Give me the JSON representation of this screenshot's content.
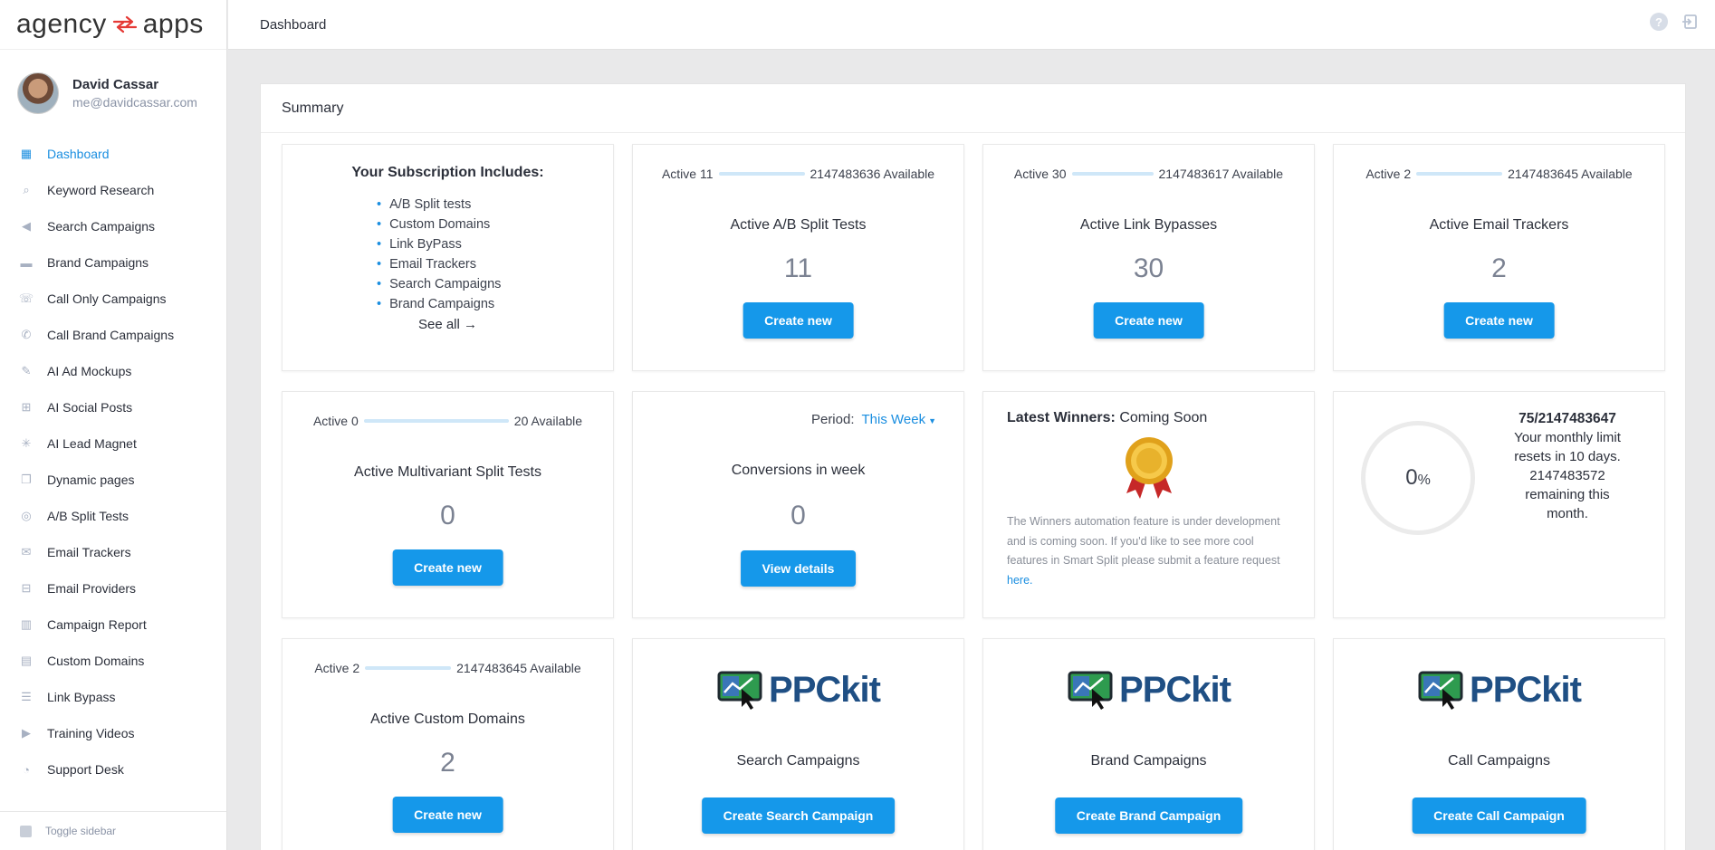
{
  "brand": {
    "logo_left": "agency",
    "logo_right": "apps"
  },
  "user": {
    "name": "David Cassar",
    "email": "me@davidcassar.com"
  },
  "sidebar": {
    "items": [
      {
        "label": "Dashboard",
        "icon": "grid-icon"
      },
      {
        "label": "Keyword Research",
        "icon": "search-icon"
      },
      {
        "label": "Search Campaigns",
        "icon": "megaphone-icon"
      },
      {
        "label": "Brand Campaigns",
        "icon": "card-icon"
      },
      {
        "label": "Call Only Campaigns",
        "icon": "phone-icon"
      },
      {
        "label": "Call Brand Campaigns",
        "icon": "phone-call-icon"
      },
      {
        "label": "AI Ad Mockups",
        "icon": "pencil-icon"
      },
      {
        "label": "AI Social Posts",
        "icon": "social-icon"
      },
      {
        "label": "AI Lead Magnet",
        "icon": "sparkle-icon"
      },
      {
        "label": "Dynamic pages",
        "icon": "pages-icon"
      },
      {
        "label": "A/B Split Tests",
        "icon": "split-icon"
      },
      {
        "label": "Email Trackers",
        "icon": "mail-icon"
      },
      {
        "label": "Email Providers",
        "icon": "inbox-icon"
      },
      {
        "label": "Campaign Report",
        "icon": "chart-icon"
      },
      {
        "label": "Custom Domains",
        "icon": "building-icon"
      },
      {
        "label": "Link Bypass",
        "icon": "list-icon"
      },
      {
        "label": "Training Videos",
        "icon": "video-icon"
      },
      {
        "label": "Support Desk",
        "icon": "headset-icon"
      }
    ],
    "toggle_label": "Toggle sidebar"
  },
  "topbar": {
    "title": "Dashboard"
  },
  "summary": {
    "title": "Summary"
  },
  "subscription": {
    "title": "Your Subscription Includes:",
    "items": [
      "A/B Split tests",
      "Custom Domains",
      "Link ByPass",
      "Email Trackers",
      "Search Campaigns",
      "Brand Campaigns"
    ],
    "see_all": "See all"
  },
  "ab_tests": {
    "active": "Active 11",
    "available": "2147483636 Available",
    "title": "Active A/B Split Tests",
    "value": "11",
    "button": "Create new"
  },
  "link_bypasses": {
    "active": "Active 30",
    "available": "2147483617 Available",
    "title": "Active Link Bypasses",
    "value": "30",
    "button": "Create new"
  },
  "email_trackers": {
    "active": "Active 2",
    "available": "2147483645 Available",
    "title": "Active Email Trackers",
    "value": "2",
    "button": "Create new"
  },
  "multivariant": {
    "active": "Active 0",
    "available": "20 Available",
    "title": "Active Multivariant Split Tests",
    "value": "0",
    "button": "Create new"
  },
  "conversions": {
    "period_label": "Period:",
    "period_value": "This Week",
    "title": "Conversions in week",
    "value": "0",
    "button": "View details"
  },
  "winners": {
    "title_bold": "Latest Winners:",
    "title_rest": " Coming Soon",
    "text": "The Winners automation feature is under development and is coming soon. If you'd like to see more cool features in Smart Split please submit a feature request ",
    "link": "here."
  },
  "limit": {
    "percent": "0",
    "percent_sign": "%",
    "count": "75/2147483647",
    "line1": "Your monthly limit",
    "line2": "resets in 10 days.",
    "line3": "2147483572",
    "line4": "remaining this",
    "line5": "month."
  },
  "custom_domains": {
    "active": "Active 2",
    "available": "2147483645 Available",
    "title": "Active Custom Domains",
    "value": "2",
    "button": "Create new"
  },
  "ppc_logo_text": "PPCkit",
  "ppc_search": {
    "title": "Search Campaigns",
    "button": "Create Search Campaign"
  },
  "ppc_brand": {
    "title": "Brand Campaigns",
    "button": "Create Brand Campaign"
  },
  "ppc_call": {
    "title": "Call Campaigns",
    "button": "Create Call Campaign"
  },
  "colors": {
    "accent": "#1598ea",
    "logo_arrow": "#e53935",
    "ppc_blue": "#1f4f84",
    "ppc_green": "#2e9b4f"
  }
}
